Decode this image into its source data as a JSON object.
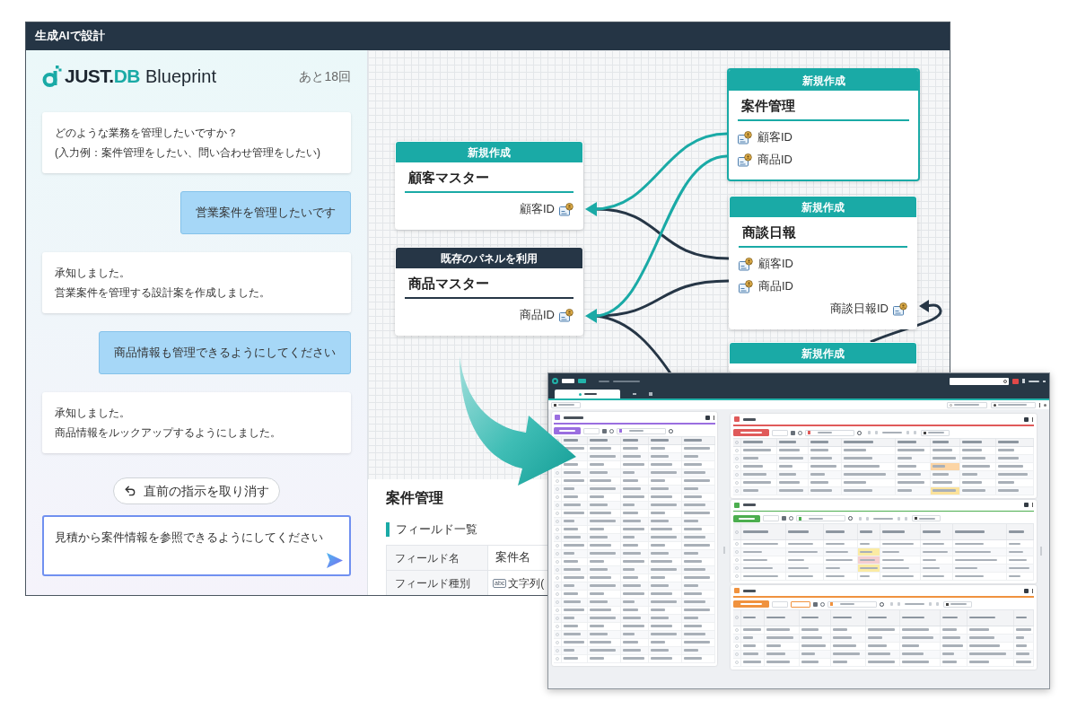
{
  "window": {
    "title": "生成AIで設計"
  },
  "assistant": {
    "logo": {
      "wordmark": [
        {
          "text": "JUST.",
          "kind": "plain"
        },
        {
          "text": "DB",
          "kind": "accent"
        }
      ],
      "product": "Blueprint"
    },
    "remaining": "あと18回",
    "messages": [
      {
        "kind": "assistant",
        "lines": [
          "どのような業務を管理したいですか？",
          "(入力例：案件管理をしたい、問い合わせ管理をしたい)"
        ]
      },
      {
        "kind": "user",
        "lines": [
          "営業案件を管理したいです"
        ]
      },
      {
        "kind": "assistant",
        "lines": [
          "承知しました。",
          "営業案件を管理する設計案を作成しました。"
        ]
      },
      {
        "kind": "user",
        "lines": [
          "商品情報も管理できるようにしてください"
        ]
      },
      {
        "kind": "assistant",
        "lines": [
          "承知しました。",
          "商品情報をルックアップするようにしました。"
        ]
      }
    ],
    "undo_button": {
      "label": "直前の指示を取り消す"
    },
    "input": {
      "value": "見積から案件情報を参照できるようにしてください"
    }
  },
  "canvas": {
    "nodes": [
      {
        "header": "新規作成",
        "kind": "new",
        "title": "顧客マスター",
        "selected": false,
        "fields": [
          {
            "label": "顧客ID",
            "kind": "key"
          }
        ]
      },
      {
        "header": "既存のパネルを利用",
        "kind": "existing",
        "title": "商品マスター",
        "selected": false,
        "fields": [
          {
            "label": "商品ID",
            "kind": "key"
          }
        ]
      },
      {
        "header": "新規作成",
        "kind": "new",
        "title": "案件管理",
        "selected": true,
        "fields": [
          {
            "label": "顧客ID",
            "kind": "lookup"
          },
          {
            "label": "商品ID",
            "kind": "lookup"
          }
        ]
      },
      {
        "header": "新規作成",
        "kind": "new",
        "title": "商談日報",
        "selected": false,
        "fields": [
          {
            "label": "顧客ID",
            "kind": "lookup"
          },
          {
            "label": "商品ID",
            "kind": "lookup"
          },
          {
            "label": "商談日報ID",
            "kind": "key"
          }
        ]
      },
      {
        "header": "新規作成",
        "kind": "new",
        "selected": false
      }
    ]
  },
  "detail_panel": {
    "title": "案件管理",
    "section": "フィールド一覧",
    "rows": [
      {
        "label": "フィールド名",
        "value": "案件名"
      },
      {
        "label": "フィールド種別",
        "badge": "abc",
        "value": "文字列("
      }
    ]
  }
}
